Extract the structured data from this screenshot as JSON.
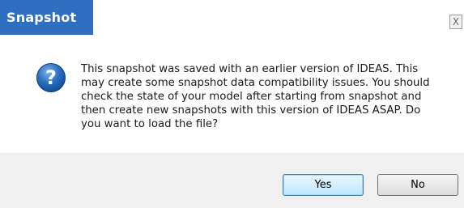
{
  "window": {
    "title": "Snapshot",
    "close_glyph": "X"
  },
  "message": {
    "icon": "question-icon",
    "text": "This snapshot was saved with an earlier version of IDEAS. This\nmay create some snapshot data compatibility issues. You should\ncheck the state of your model after starting from snapshot and\nthen create new snapshots with this version of IDEAS ASAP. Do\nyou want to load the file?"
  },
  "buttons": {
    "yes_label": "Yes",
    "no_label": "No"
  },
  "colors": {
    "title_bar": "#2f6fc2",
    "icon_blue": "#1f64b3"
  }
}
